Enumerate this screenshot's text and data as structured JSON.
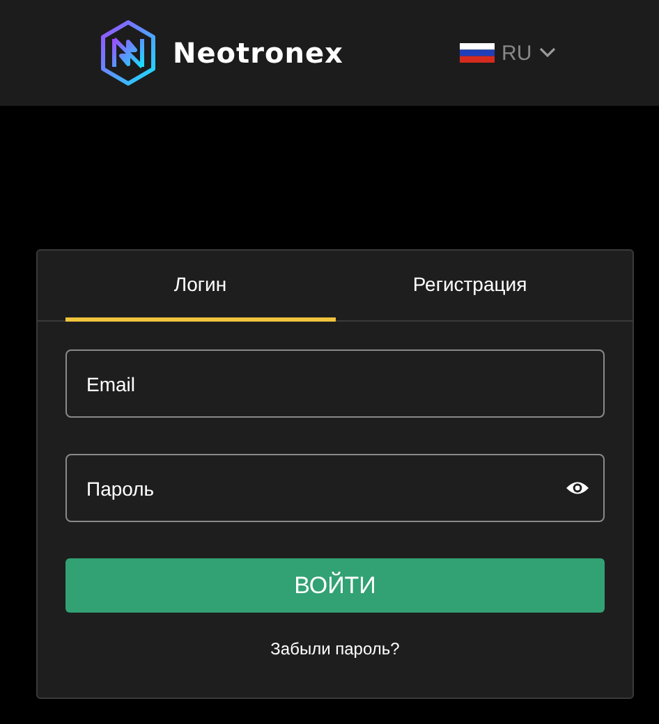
{
  "header": {
    "brand": "Neotronex",
    "language": "RU"
  },
  "tabs": [
    {
      "label": "Логин",
      "selected": true
    },
    {
      "label": "Регистрация",
      "selected": false
    }
  ],
  "fields": [
    {
      "placeholder": "Email",
      "kind": "text"
    },
    {
      "placeholder": "Пароль",
      "kind": "password"
    }
  ],
  "submit": "ВОЙТИ",
  "forgot": "Забыли пароль?"
}
